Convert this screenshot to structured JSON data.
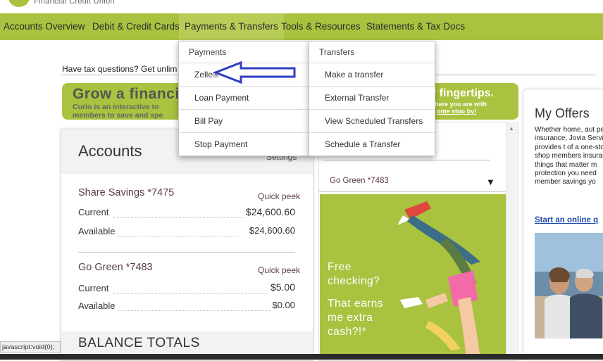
{
  "brand": {
    "logo_text": "Financial Credit Union",
    "color": "#a9c23f"
  },
  "nav": {
    "items": [
      "Accounts Overview",
      "Debit & Credit Cards",
      "Payments & Transfers",
      "Tools & Resources",
      "Statements & Tax Docs"
    ],
    "active": "Payments & Transfers"
  },
  "dropdown": {
    "payments": {
      "header": "Payments",
      "items": [
        "Zelle®",
        "Loan Payment",
        "Bill Pay",
        "Stop Payment"
      ]
    },
    "transfers": {
      "header": "Transfers",
      "items": [
        "Make a transfer",
        "External Transfer",
        "View Scheduled Transfers",
        "Schedule a Transfer"
      ]
    },
    "annotation": "arrow-pointing-to-zelle"
  },
  "tax_banner": "Have tax questions? Get unlim",
  "promo": {
    "title": "Grow a financial",
    "subtitle": "Curio is an interactive to members to save and spe",
    "right_title": "r fingertips.",
    "right_sub": "where you are with",
    "right_link": "ome stop by!"
  },
  "accounts": {
    "title": "Accounts",
    "settings": "Settings",
    "list": [
      {
        "name": "Share Savings  *7475",
        "quick": "Quick peek",
        "current_label": "Current",
        "current": "$24,600.60",
        "available_label": "Available",
        "available": "$24,600.60"
      },
      {
        "name": "Go Green  *7483",
        "quick": "Quick peek",
        "current_label": "Current",
        "current": "$5.00",
        "available_label": "Available",
        "available": "$0.00"
      }
    ],
    "totals": "BALANCE TOTALS"
  },
  "account_select": {
    "value": "Go Green *7483"
  },
  "ad": {
    "line1": "Free",
    "line2": "checking?",
    "line3": "That earns",
    "line4": "me extra",
    "line5": "cash?!*"
  },
  "offers": {
    "title": "My Offers",
    "body": "Whether home, aut pet insurance, Jovia Services provides t of a one-stop shop members insurance things that matter m protection you need member savings yo",
    "link": "Start an online q"
  },
  "status_bar": "javascript:void(0);"
}
